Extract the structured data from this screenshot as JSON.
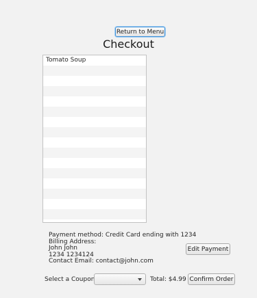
{
  "header": {
    "return_label": "Return to Menu",
    "title": "Checkout"
  },
  "order": {
    "items": [
      "Tomato Soup"
    ],
    "visible_rows": 16
  },
  "payment": {
    "method": "Payment method: Credit Card ending with 1234",
    "billing_label": "Billing Address:",
    "name": "John John",
    "address": "1234 1234124",
    "contact": "Contact Email: contact@john.com",
    "edit_label": "Edit Payment"
  },
  "footer": {
    "coupon_label": "Select a Coupon",
    "coupon_value": "",
    "total": "Total: $4.99",
    "confirm_label": "Confirm Order"
  }
}
